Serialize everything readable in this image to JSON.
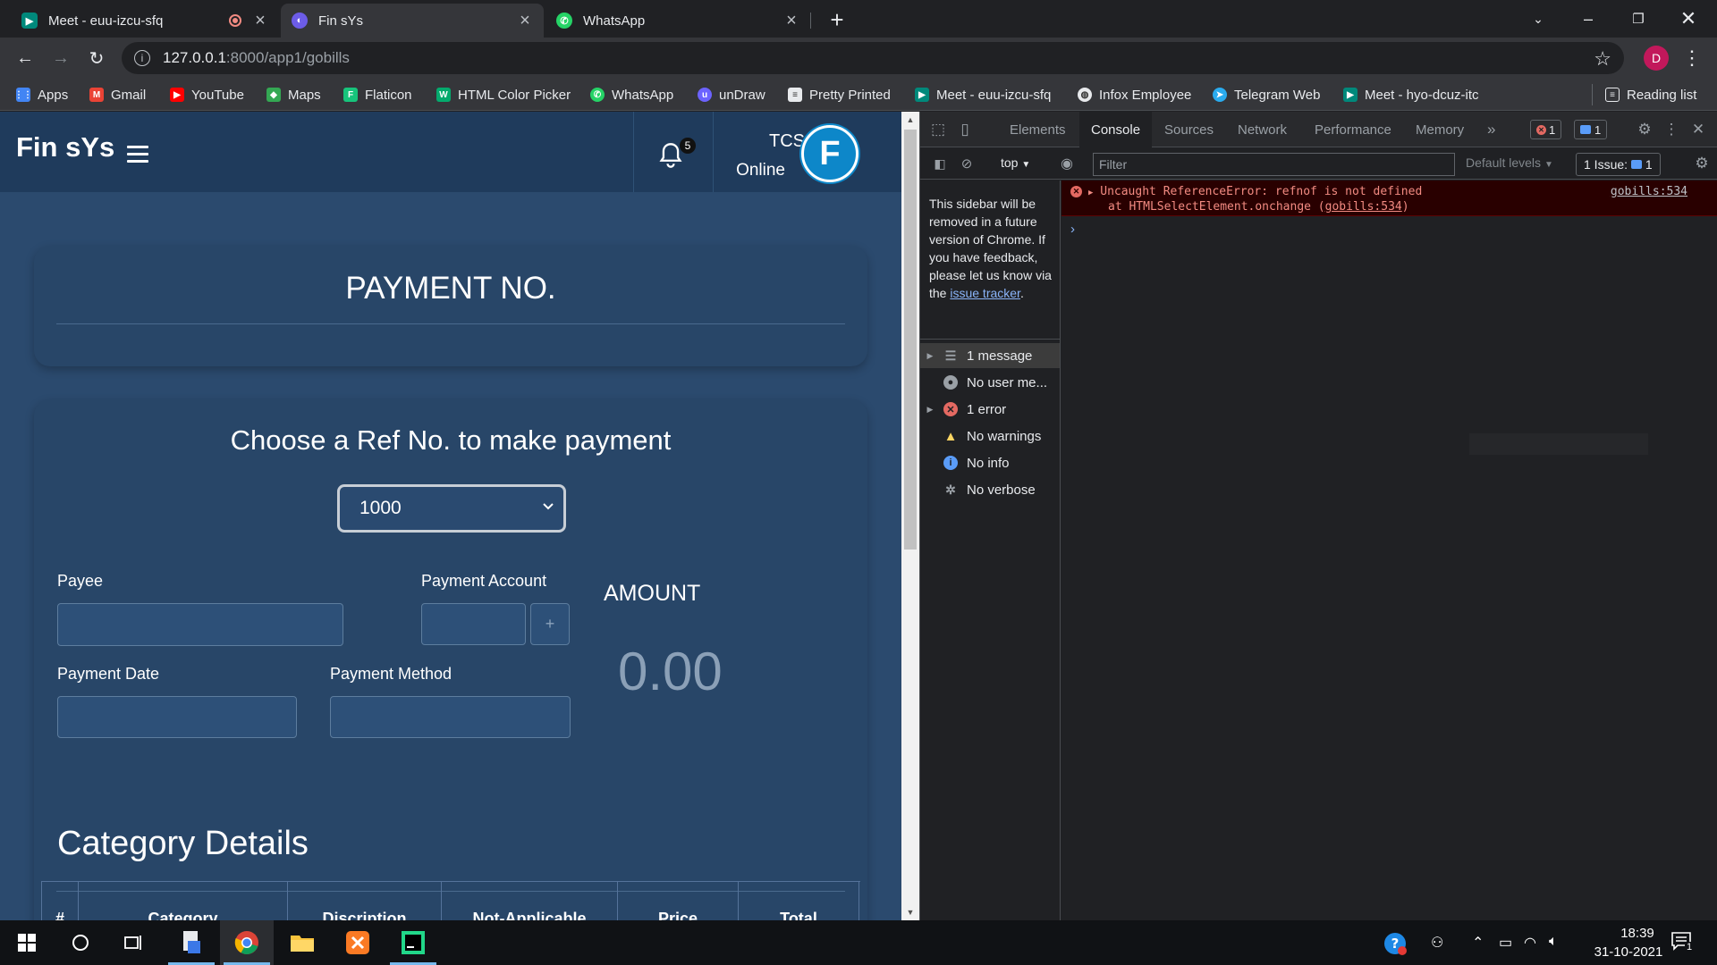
{
  "browser": {
    "tabs": [
      {
        "title": "Meet - euu-izcu-sfq",
        "icon": "google-meet-icon",
        "recording": true
      },
      {
        "title": "Fin sYs",
        "icon": "app-favicon",
        "active": true
      },
      {
        "title": "WhatsApp",
        "icon": "whatsapp-icon"
      }
    ],
    "url_host": "127.0.0.1",
    "url_path": ":8000/app1/gobills",
    "profile_initial": "D",
    "bookmarks": [
      {
        "label": "Apps",
        "icon": "apps-grid-icon",
        "color": "#4285f4"
      },
      {
        "label": "Gmail",
        "icon": "gmail-icon",
        "color": "#ea4335"
      },
      {
        "label": "YouTube",
        "icon": "youtube-icon",
        "color": "#ff0000"
      },
      {
        "label": "Maps",
        "icon": "maps-icon",
        "color": "#34a853"
      },
      {
        "label": "Flaticon",
        "icon": "flaticon-icon",
        "color": "#17c47b"
      },
      {
        "label": "HTML Color Picker",
        "icon": "w3schools-icon",
        "color": "#04aa6d"
      },
      {
        "label": "WhatsApp",
        "icon": "whatsapp-icon",
        "color": "#25d366"
      },
      {
        "label": "unDraw",
        "icon": "undraw-icon",
        "color": "#6c63ff"
      },
      {
        "label": "Pretty Printed",
        "icon": "page-icon",
        "color": "#e8eaed"
      },
      {
        "label": "Meet - euu-izcu-sfq",
        "icon": "google-meet-icon",
        "color": "#00897b"
      },
      {
        "label": "Infox Employee",
        "icon": "globe-icon",
        "color": "#e8eaed"
      },
      {
        "label": "Telegram Web",
        "icon": "telegram-icon",
        "color": "#2aabee"
      },
      {
        "label": "Meet - hyo-dcuz-itc",
        "icon": "google-meet-icon",
        "color": "#00897b"
      }
    ],
    "reading_list": "Reading list"
  },
  "app": {
    "brand": "Fin sYs",
    "notification_count": "5",
    "user_name": "TCS",
    "user_status": "Online",
    "avatar_letter": "F",
    "payment_title": "PAYMENT NO.",
    "choose_title": "Choose a Ref No. to make payment",
    "ref_selected": "1000",
    "labels": {
      "payee": "Payee",
      "payment_account": "Payment Account",
      "payment_date": "Payment Date",
      "payment_method": "Payment Method",
      "amount": "AMOUNT"
    },
    "add_account_label": "+",
    "amount_value": "0.00",
    "category_title": "Category Details",
    "table_headers": [
      "#",
      "Category",
      "Discription",
      "Not-Applicable",
      "Price",
      "Total"
    ]
  },
  "devtools": {
    "tabs": [
      "Elements",
      "Console",
      "Sources",
      "Network",
      "Performance",
      "Memory"
    ],
    "active_tab": "Console",
    "more": "»",
    "error_badge": "1",
    "message_badge": "1",
    "context": "top",
    "filter_placeholder": "Filter",
    "levels": "Default levels",
    "issues": "1 Issue:",
    "issues_count": "1",
    "sidebar_note_pre": "This sidebar will be removed in a future version of Chrome. If you have feedback, please let us know via the",
    "sidebar_note_link": "issue tracker",
    "sidebar_note_post": ".",
    "sidebar_items": [
      {
        "label": "1 message",
        "icon": "list-icon",
        "expandable": true
      },
      {
        "label": "No user me...",
        "icon": "user-icon",
        "expandable": false
      },
      {
        "label": "1 error",
        "icon": "error-icon",
        "expandable": true
      },
      {
        "label": "No warnings",
        "icon": "warning-icon",
        "expandable": false
      },
      {
        "label": "No info",
        "icon": "info-icon",
        "expandable": false
      },
      {
        "label": "No verbose",
        "icon": "bug-icon",
        "expandable": false
      }
    ],
    "error_line1": "Uncaught ReferenceError: refnof is not defined",
    "error_line2_pre": "at HTMLSelectElement.onchange (",
    "error_line2_link": "gobills:534",
    "error_line2_post": ")",
    "error_source": "gobills:534",
    "prompt": "›"
  },
  "taskbar": {
    "time": "18:39",
    "date": "31-10-2021",
    "notification_count": "1"
  },
  "colors": {
    "app_header": "#1f3b5c",
    "app_body": "#2b4a6e",
    "card": "#284668",
    "error_bg": "#290000",
    "error_text": "#f28b82",
    "avatar": "#0d87c9"
  }
}
